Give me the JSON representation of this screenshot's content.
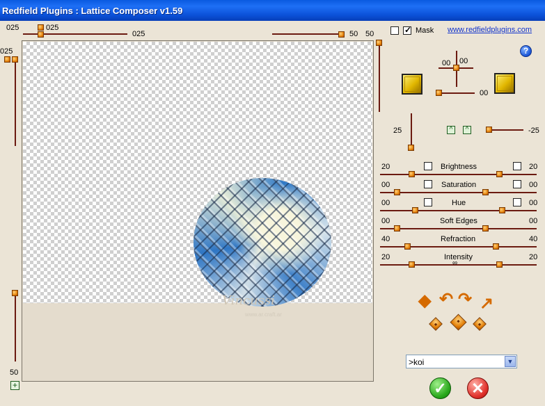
{
  "window": {
    "title": "Redfield Plugins : Lattice Composer v1.59"
  },
  "top_controls": {
    "left_value_top": "025",
    "knob_value": "025",
    "slider_value_mid": "025",
    "left_side_value": "025",
    "right_slider_value": "50",
    "right_slider_value2": "50",
    "bottom_left_value": "50"
  },
  "mask": {
    "label": "Mask",
    "checked": true
  },
  "link": {
    "text": "www.redfieldplugins.com"
  },
  "help": {
    "symbol": "?"
  },
  "light": {
    "x_value": "00",
    "y_value": "00",
    "slider_value": "00"
  },
  "depth": {
    "value": "25",
    "angle": "-25"
  },
  "adjustments": [
    {
      "label": "Brightness",
      "left": "20",
      "right": "20",
      "left_checked": false,
      "right_checked": false
    },
    {
      "label": "Saturation",
      "left": "00",
      "right": "00",
      "left_checked": false,
      "right_checked": false
    },
    {
      "label": "Hue",
      "left": "00",
      "right": "00",
      "left_checked": false,
      "right_checked": false
    },
    {
      "label": "Soft Edges",
      "left": "00",
      "right": "00"
    },
    {
      "label": "Refraction",
      "left": "40",
      "right": "40"
    },
    {
      "label": "Intensity",
      "left": "20",
      "right": "20"
    }
  ],
  "preset": {
    "selected": ">koi"
  },
  "watermark": {
    "text": "Vincussi",
    "subtext": "www.ar.craft.ar"
  },
  "colors": {
    "titlebar": "#0a5ae0",
    "panel": "#ebe4d6",
    "accent": "#e07800",
    "track": "#6b1a10"
  }
}
